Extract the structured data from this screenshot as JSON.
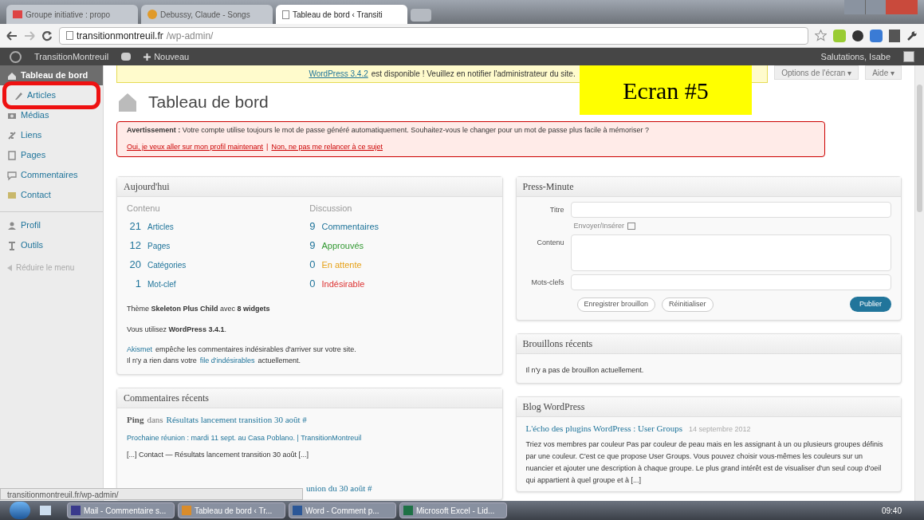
{
  "browser": {
    "tabs": [
      {
        "label": "Groupe initiative : propo",
        "kind": "mail",
        "selected": false
      },
      {
        "label": "Debussy, Claude - Songs",
        "kind": "music",
        "selected": false
      },
      {
        "label": "Tableau de bord ‹ Transiti",
        "kind": "page",
        "selected": true
      }
    ],
    "address": {
      "host": "transitionmontreuil.fr",
      "path": "/wp-admin/"
    }
  },
  "admin_bar": {
    "site": "TransitionMontreuil",
    "new": "Nouveau",
    "greeting": "Salutations, Isabe"
  },
  "sidebar": {
    "items": [
      {
        "label": "Tableau de bord",
        "selected": true,
        "marked": false
      },
      {
        "label": "Articles",
        "selected": false,
        "marked": true
      },
      {
        "label": "Médias",
        "selected": false,
        "marked": false
      },
      {
        "label": "Liens",
        "selected": false,
        "marked": false
      },
      {
        "label": "Pages",
        "selected": false,
        "marked": false
      },
      {
        "label": "Commentaires",
        "selected": false,
        "marked": false
      },
      {
        "label": "Contact",
        "selected": false,
        "marked": false
      },
      {
        "label": "Profil",
        "selected": false,
        "marked": false
      },
      {
        "label": "Outils",
        "selected": false,
        "marked": false
      }
    ],
    "collapse": "Réduire le menu"
  },
  "update_notice": {
    "link": "WordPress 3.4.2",
    "text": "est disponible ! Veuillez en notifier l'administrateur du site."
  },
  "screen_options": "Options de l'écran ▾",
  "help": "Aide ▾",
  "annotation": "Ecran #5",
  "page_title": "Tableau de bord",
  "warning": {
    "text": "**Avertissement :** Votre compte utilise toujours le mot de passe généré automatiquement. Souhaitez-vous le changer pour un mot de passe plus facile à mémoriser ?",
    "link_yes": "Oui, je veux aller sur mon profil maintenant",
    "separator": "|",
    "link_no": "Non, ne pas me relancer à ce sujet"
  },
  "today": {
    "title": "Aujourd'hui",
    "content_heading": "Contenu",
    "discussion_heading": "Discussion",
    "content": [
      {
        "count": "21",
        "label": "Articles"
      },
      {
        "count": "12",
        "label": "Pages"
      },
      {
        "count": "20",
        "label": "Catégories"
      },
      {
        "count": "1",
        "label": "Mot-clef"
      }
    ],
    "discussion": [
      {
        "count": "9",
        "label": "Commentaires",
        "color": "#21759b"
      },
      {
        "count": "9",
        "label": "Approuvés",
        "color": "#339933"
      },
      {
        "count": "0",
        "label": "En attente",
        "color": "#e6a117"
      },
      {
        "count": "0",
        "label": "Indésirable",
        "color": "#dd3333"
      }
    ],
    "theme": "Thème **Skeleton Plus Child** avec **8 widgets**",
    "version": "Vous utilisez **WordPress 3.4.1**.",
    "akismet_link": "Akismet",
    "akismet_text": "empêche les commentaires indésirables d'arriver sur votre site.",
    "spam_before": "Il n'y a rien dans votre",
    "spam_link": "file d'indésirables",
    "spam_after": "actuellement."
  },
  "recent_comments": {
    "title": "Commentaires récents",
    "items": [
      {
        "type": "Ping",
        "in": "dans",
        "post": "Résultats lancement transition 30 août #",
        "source": "Prochaine réunion : mardi 11 sept. au Casa Poblano. | TransitionMontreuil",
        "excerpt": "[...] Contact — Résultats lancement transition 30 août [...]"
      }
    ],
    "partial": "union du 30 août #"
  },
  "quick_press": {
    "title": "Press-Minute",
    "title_label": "Titre",
    "media_label": "Envoyer/Insérer",
    "content_label": "Contenu",
    "tags_label": "Mots-clefs",
    "save": "Enregistrer brouillon",
    "reset": "Réinitialiser",
    "publish": "Publier"
  },
  "drafts": {
    "title": "Brouillons récents",
    "text": "Il n'y a pas de brouillon actuellement."
  },
  "blog": {
    "title": "Blog WordPress",
    "post": "L'écho des plugins WordPress : User Groups",
    "date": "14 septembre 2012",
    "text": "Triez vos membres par couleur Pas par couleur de peau mais en les assignant à un ou plusieurs groupes définis par une couleur. C'est ce que propose User Groups. Vous pouvez choisir vous-mêmes les couleurs sur un nuancier et ajouter une description à chaque groupe. Le plus grand intérêt est de visualiser d'un seul coup d'oeil qui appartient à quel groupe et à [...]"
  },
  "status_url": "transitionmontreuil.fr/wp-admin/",
  "taskbar": {
    "items": [
      {
        "label": "Mail - Commentaire s..."
      },
      {
        "label": "Tableau de bord ‹ Tr..."
      },
      {
        "label": "Word - Comment p..."
      },
      {
        "label": "Microsoft Excel - Lid..."
      }
    ],
    "time": "09:40"
  }
}
